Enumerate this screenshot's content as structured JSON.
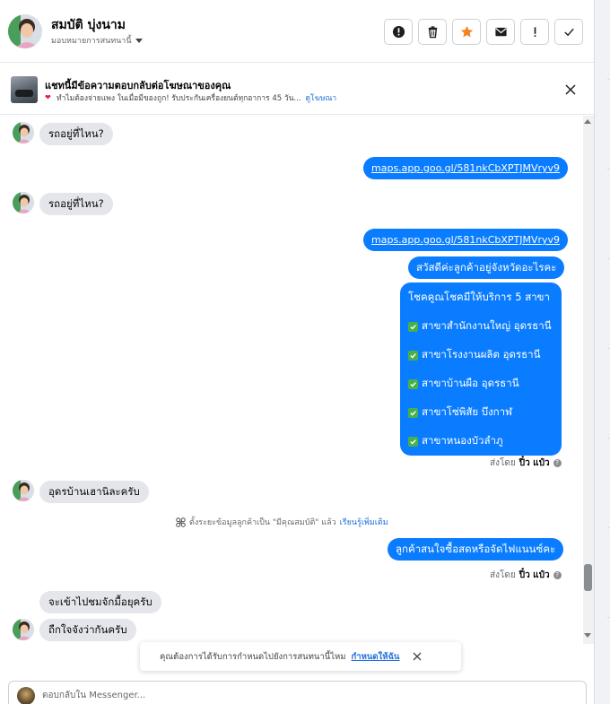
{
  "header": {
    "contact_name": "สมบัติ บุ่งนาม",
    "assign_label": "มอบหมายการสนทนานี้",
    "toolbar": [
      {
        "name": "alert-button",
        "icon": "alert-circle-icon"
      },
      {
        "name": "delete-button",
        "icon": "trash-icon"
      },
      {
        "name": "star-button",
        "icon": "star-icon"
      },
      {
        "name": "mark-unread-button",
        "icon": "envelope-icon"
      },
      {
        "name": "follow-up-button",
        "icon": "exclamation-icon"
      },
      {
        "name": "done-button",
        "icon": "check-icon"
      }
    ],
    "accent_star": "#f5821f"
  },
  "ad": {
    "title": "แชทนี้มีข้อความตอบกลับต่อโฆษณาของคุณ",
    "description": "ทำไมต้องจ่ายแพง ในเมื่อมีของถูก! รับประกันเครื่องยนต์ทุกอาการ 45 วัน...",
    "link": "ดูโฆษณา"
  },
  "messages": {
    "m1": "รถอยู่ที่ไหน?",
    "m2": "maps.app.goo.gl/581nkCbXPTJMVryv9",
    "m3": "รถอยู่ที่ไหน?",
    "m4": "maps.app.goo.gl/581nkCbXPTJMVryv9",
    "m5": "สวัสดีค่ะลูกค้าอยู่จังหวัดอะไรคะ",
    "m6_title": "โชคคูณโชคมีให้บริการ 5 สาขา",
    "m6_items": [
      "สาขาสำนักงานใหญ่ อุดรธานี",
      "สาขาโรงงานผลิต อุดรธานี",
      "สาขาบ้านผือ อุดรธานี",
      "สาขาโซ่พิสัย บึงกาฬ",
      "สาขาหนองบัวลำภู"
    ],
    "m7": "อุดรบ้านเฮานิละครับ",
    "m8": "ลูกค้าสนใจซื้อสดหรือจัดไฟแนนซ์คะ",
    "m9": "จะเข้าไปชมจักมื้อยุครับ",
    "m10": "ถืกใจจังว่ากันครับ"
  },
  "sent_by": {
    "prefix": "ส่งโดย",
    "name": "ปิ๋ว แป๋ว"
  },
  "system_note": {
    "text": "ตั้งระยะข้อมูลลูกค้าเป็น \"มีคุณสมบัติ\" แล้ว",
    "link": "เรียนรู้เพิ่มเติม"
  },
  "toast": {
    "text": "คุณต้องการได้รับการกำหนดไปยังการสนทนานี้ไหม",
    "link": "กำหนดให้ฉัน"
  },
  "reply": {
    "placeholder": "ตอบกลับใน Messenger..."
  },
  "colors": {
    "outgoing_bubble": "#0a7cff",
    "incoming_bubble": "#e4e6eb",
    "link": "#216fdb",
    "check_green": "#47b04b"
  }
}
